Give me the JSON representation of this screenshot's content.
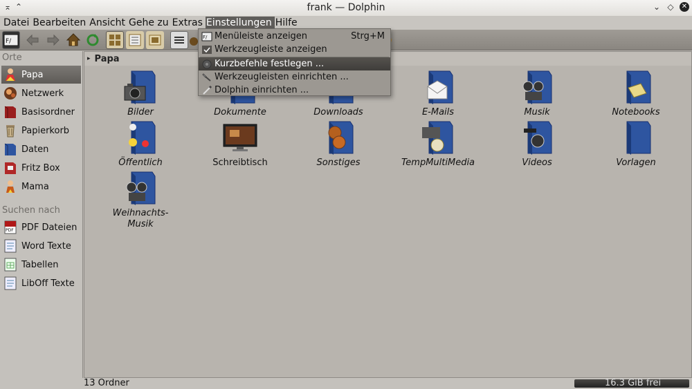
{
  "window": {
    "title": "frank — Dolphin"
  },
  "menubar": [
    "Datei",
    "Bearbeiten",
    "Ansicht",
    "Gehe zu",
    "Extras",
    "Einstellungen",
    "Hilfe"
  ],
  "active_menu": "Einstellungen",
  "dropdown": {
    "items": [
      {
        "label": "Menüleiste anzeigen",
        "shortcut": "Strg+M",
        "icon": "menubar-icon",
        "highlighted": false
      },
      {
        "label": "Werkzeugleiste anzeigen",
        "shortcut": "",
        "icon": "check-icon",
        "highlighted": false
      },
      {
        "label": "Kurzbefehle festlegen ...",
        "shortcut": "",
        "icon": "keyboard-icon",
        "highlighted": true
      },
      {
        "label": "Werkzeugleisten einrichten ...",
        "shortcut": "",
        "icon": "wrench-icon",
        "highlighted": false
      },
      {
        "label": "Dolphin einrichten ...",
        "shortcut": "",
        "icon": "screwdriver-icon",
        "highlighted": false
      }
    ]
  },
  "places": {
    "section_places": "Orte",
    "section_search": "Suchen nach",
    "items": [
      {
        "label": "Papa",
        "icon": "person-icon",
        "selected": true
      },
      {
        "label": "Netzwerk",
        "icon": "network-icon",
        "selected": false
      },
      {
        "label": "Basisordner",
        "icon": "folder-red-icon",
        "selected": false
      },
      {
        "label": "Papierkorb",
        "icon": "trash-icon",
        "selected": false
      },
      {
        "label": "Daten",
        "icon": "folder-blue-icon",
        "selected": false
      },
      {
        "label": "Fritz Box",
        "icon": "folder-red-icon",
        "selected": false
      },
      {
        "label": "Mama",
        "icon": "person-icon",
        "selected": false
      }
    ],
    "search": [
      {
        "label": "PDF Dateien",
        "icon": "pdf-icon"
      },
      {
        "label": "Word Texte",
        "icon": "document-icon"
      },
      {
        "label": "Tabellen",
        "icon": "spreadsheet-icon"
      },
      {
        "label": "LibOff Texte",
        "icon": "document-icon"
      }
    ]
  },
  "breadcrumb": "Papa",
  "items": [
    {
      "label": "Bilder",
      "icon": "folder-camera-icon"
    },
    {
      "label": "Dokumente",
      "icon": "folder-documents-icon"
    },
    {
      "label": "Downloads",
      "icon": "folder-downloads-icon"
    },
    {
      "label": "E-Mails",
      "icon": "folder-mail-icon"
    },
    {
      "label": "Musik",
      "icon": "folder-music-icon"
    },
    {
      "label": "Notebooks",
      "icon": "folder-notes-icon"
    },
    {
      "label": "Öffentlich",
      "icon": "folder-public-icon"
    },
    {
      "label": "Schreibtisch",
      "icon": "desktop-monitor-icon"
    },
    {
      "label": "Sonstiges",
      "icon": "folder-film-reels-icon"
    },
    {
      "label": "TempMultiMedia",
      "icon": "folder-multimedia-icon"
    },
    {
      "label": "Videos",
      "icon": "folder-video-icon"
    },
    {
      "label": "Vorlagen",
      "icon": "folder-templates-icon"
    },
    {
      "label": "Weihnachts-\nMusik",
      "icon": "folder-music-icon"
    }
  ],
  "status": {
    "count": "13 Ordner",
    "free": "16.3 GiB frei"
  },
  "colors": {
    "folder_blue": "#3a5fa8",
    "selection": "#5e5b57",
    "toolbar": "#8a8680"
  }
}
